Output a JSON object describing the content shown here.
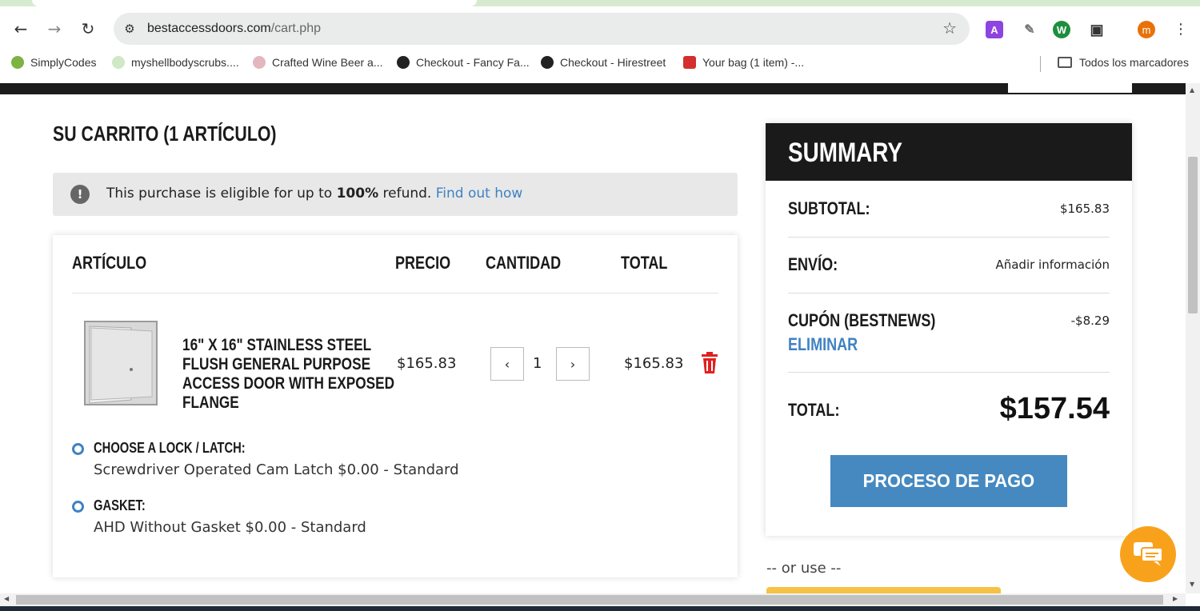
{
  "browser": {
    "url_domain": "bestaccessdoors.com",
    "url_path": "/cart.php",
    "profile_initial": "m",
    "extension_letter": "A",
    "bookmarks": [
      {
        "label": "SimplyCodes",
        "color": "#2e7d32"
      },
      {
        "label": "myshellbodyscrubs....",
        "color": "#9ccc65"
      },
      {
        "label": "Crafted Wine Beer a...",
        "color": "#c27c89"
      },
      {
        "label": "Checkout - Fancy Fa...",
        "color": "#222222"
      },
      {
        "label": "Checkout - Hirestreet",
        "color": "#222222"
      },
      {
        "label": "Your bag (1 item) -...",
        "color": "#d32f2f"
      }
    ],
    "all_bookmarks_label": "Todos los marcadores"
  },
  "cart": {
    "title": "SU CARRITO (1 ARTÍCULO)",
    "notice": {
      "text_before": "This purchase is eligible for up to ",
      "bold": "100%",
      "text_after": " refund. ",
      "link": "Find out how"
    },
    "headers": {
      "item": "ARTÍCULO",
      "price": "PRECIO",
      "quantity": "CANTIDAD",
      "total": "TOTAL"
    },
    "items": [
      {
        "name": "16\" X 16\" STAINLESS STEEL FLUSH GENERAL PURPOSE ACCESS DOOR WITH EXPOSED FLANGE",
        "price": "$165.83",
        "quantity": "1",
        "total": "$165.83",
        "decrement": "‹",
        "increment": "›",
        "options": [
          {
            "label": "CHOOSE A LOCK / LATCH:",
            "value": "Screwdriver Operated Cam Latch $0.00 - Standard"
          },
          {
            "label": "GASKET:",
            "value": "AHD Without Gasket $0.00 - Standard"
          }
        ]
      }
    ]
  },
  "summary": {
    "title": "SUMMARY",
    "subtotal_label": "SUBTOTAL:",
    "subtotal_value": "$165.83",
    "shipping_label": "ENVÍO:",
    "shipping_value": "Añadir información",
    "coupon_label": "CUPÓN (BESTNEWS)",
    "coupon_value": "-$8.29",
    "remove_label": "ELIMINAR",
    "total_label": "TOTAL:",
    "total_value": "$157.54",
    "checkout_label": "PROCESO DE PAGO",
    "or_use": "-- or use --"
  },
  "colors": {
    "accent": "#4589c0",
    "link": "#3f82c2",
    "dark": "#1a1a1a",
    "chat": "#f8a21c",
    "delete": "#e02020"
  }
}
